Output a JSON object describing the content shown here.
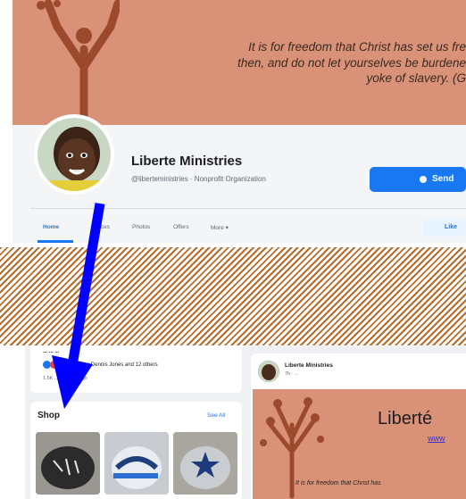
{
  "cover": {
    "quote_lines": [
      "It is for freedom that Christ has set us fre",
      "then, and do not let yourselves be burdene",
      "yoke of slavery. (G"
    ]
  },
  "profile": {
    "name": "Liberte Ministries",
    "handle": "@liberteministries · Nonprofit Organization",
    "send_label": "Send",
    "tabs": [
      "Home",
      "...ices",
      "Photos",
      "Offers",
      "More"
    ],
    "like_label": "Like"
  },
  "about": {
    "line1": "... ... ...",
    "line2": "... ...ngomery, Dennis Jones and 12 others",
    "line3": "1.5K ... ...weeks ago"
  },
  "shop": {
    "title": "Shop",
    "see_all": "See All"
  },
  "post": {
    "author": "Liberte Ministries",
    "time": "7h · ...",
    "brand": "Liberté",
    "link": "www",
    "quote": "It is for freedom that Christ has"
  },
  "colors": {
    "cover": "#d99277",
    "accent": "#1877f2",
    "hatch": "#b76a2a",
    "arrow": "#0000ff"
  }
}
